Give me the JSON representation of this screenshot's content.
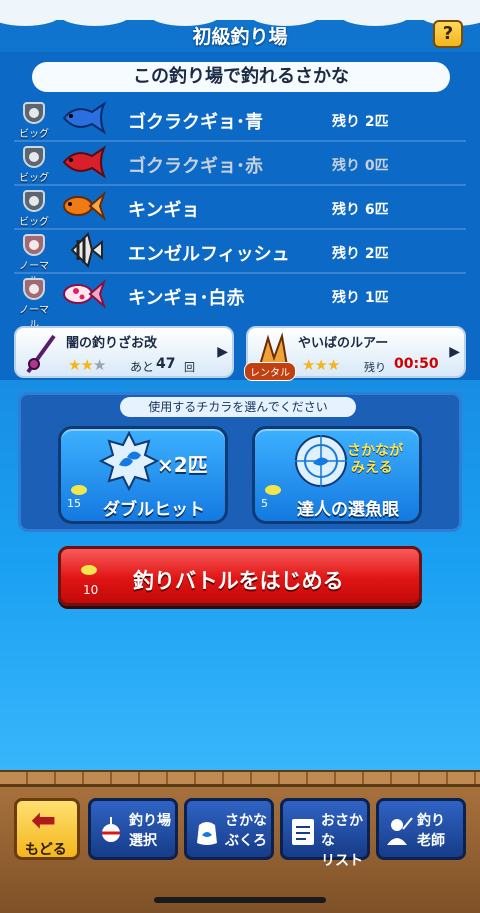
{
  "header": {
    "title": "初級釣り場",
    "help_label": "?"
  },
  "catchable": {
    "heading": "この釣り場で釣れるさかな",
    "fish": [
      {
        "name": "ゴクラクギョ･青",
        "badge": "ビッグ",
        "remaining": "残り 2匹",
        "icon": "betta-blue-icon",
        "color": "#2a6fe0",
        "dim": false
      },
      {
        "name": "ゴクラクギョ･赤",
        "badge": "ビッグ",
        "remaining": "残り 0匹",
        "icon": "betta-red-icon",
        "color": "#d8202a",
        "dim": true
      },
      {
        "name": "キンギョ",
        "badge": "ビッグ",
        "remaining": "残り 6匹",
        "icon": "goldfish-icon",
        "color": "#f07a14",
        "dim": false
      },
      {
        "name": "エンゼルフィッシュ",
        "badge": "ノーマル",
        "remaining": "残り 2匹",
        "icon": "angelfish-icon",
        "color": "#e8e8e8",
        "dim": false
      },
      {
        "name": "キンギョ･白赤",
        "badge": "ノーマル",
        "remaining": "残り 1匹",
        "icon": "goldfish-white-red-icon",
        "color": "#f3a6c8",
        "dim": false
      }
    ]
  },
  "equipment": {
    "rod": {
      "name": "闇の釣りざお改",
      "stars": 2,
      "stars_max": 3,
      "remaining_prefix": "あと",
      "remaining_value": "47",
      "remaining_suffix": "回"
    },
    "lure": {
      "name": "やいばのルアー",
      "tag": "レンタル",
      "stars": 3,
      "stars_max": 3,
      "remaining_prefix": "残り",
      "timer": "00:50"
    }
  },
  "powers": {
    "title": "使用するチカラを選んでください",
    "items": [
      {
        "label": "ダブルヒット",
        "cost": "15",
        "badge_text": "×2匹"
      },
      {
        "label": "達人の選魚眼",
        "cost": "5",
        "badge_text_line1": "さかなが",
        "badge_text_line2": "みえる"
      }
    ]
  },
  "start": {
    "label": "釣りバトルをはじめる",
    "cost": "10"
  },
  "nav": {
    "back": "もどる",
    "items": [
      {
        "line1": "釣り場",
        "line2": "選択"
      },
      {
        "line1": "さかな",
        "line2": "ぶくろ"
      },
      {
        "line1": "おさかな",
        "line2": "リスト"
      },
      {
        "line1": "釣り",
        "line2": "老師"
      }
    ]
  },
  "colors": {
    "accent_red": "#e01414",
    "gold": "#f3b51c",
    "timer_red": "#d00000",
    "sea_blue": "#1785dc"
  }
}
